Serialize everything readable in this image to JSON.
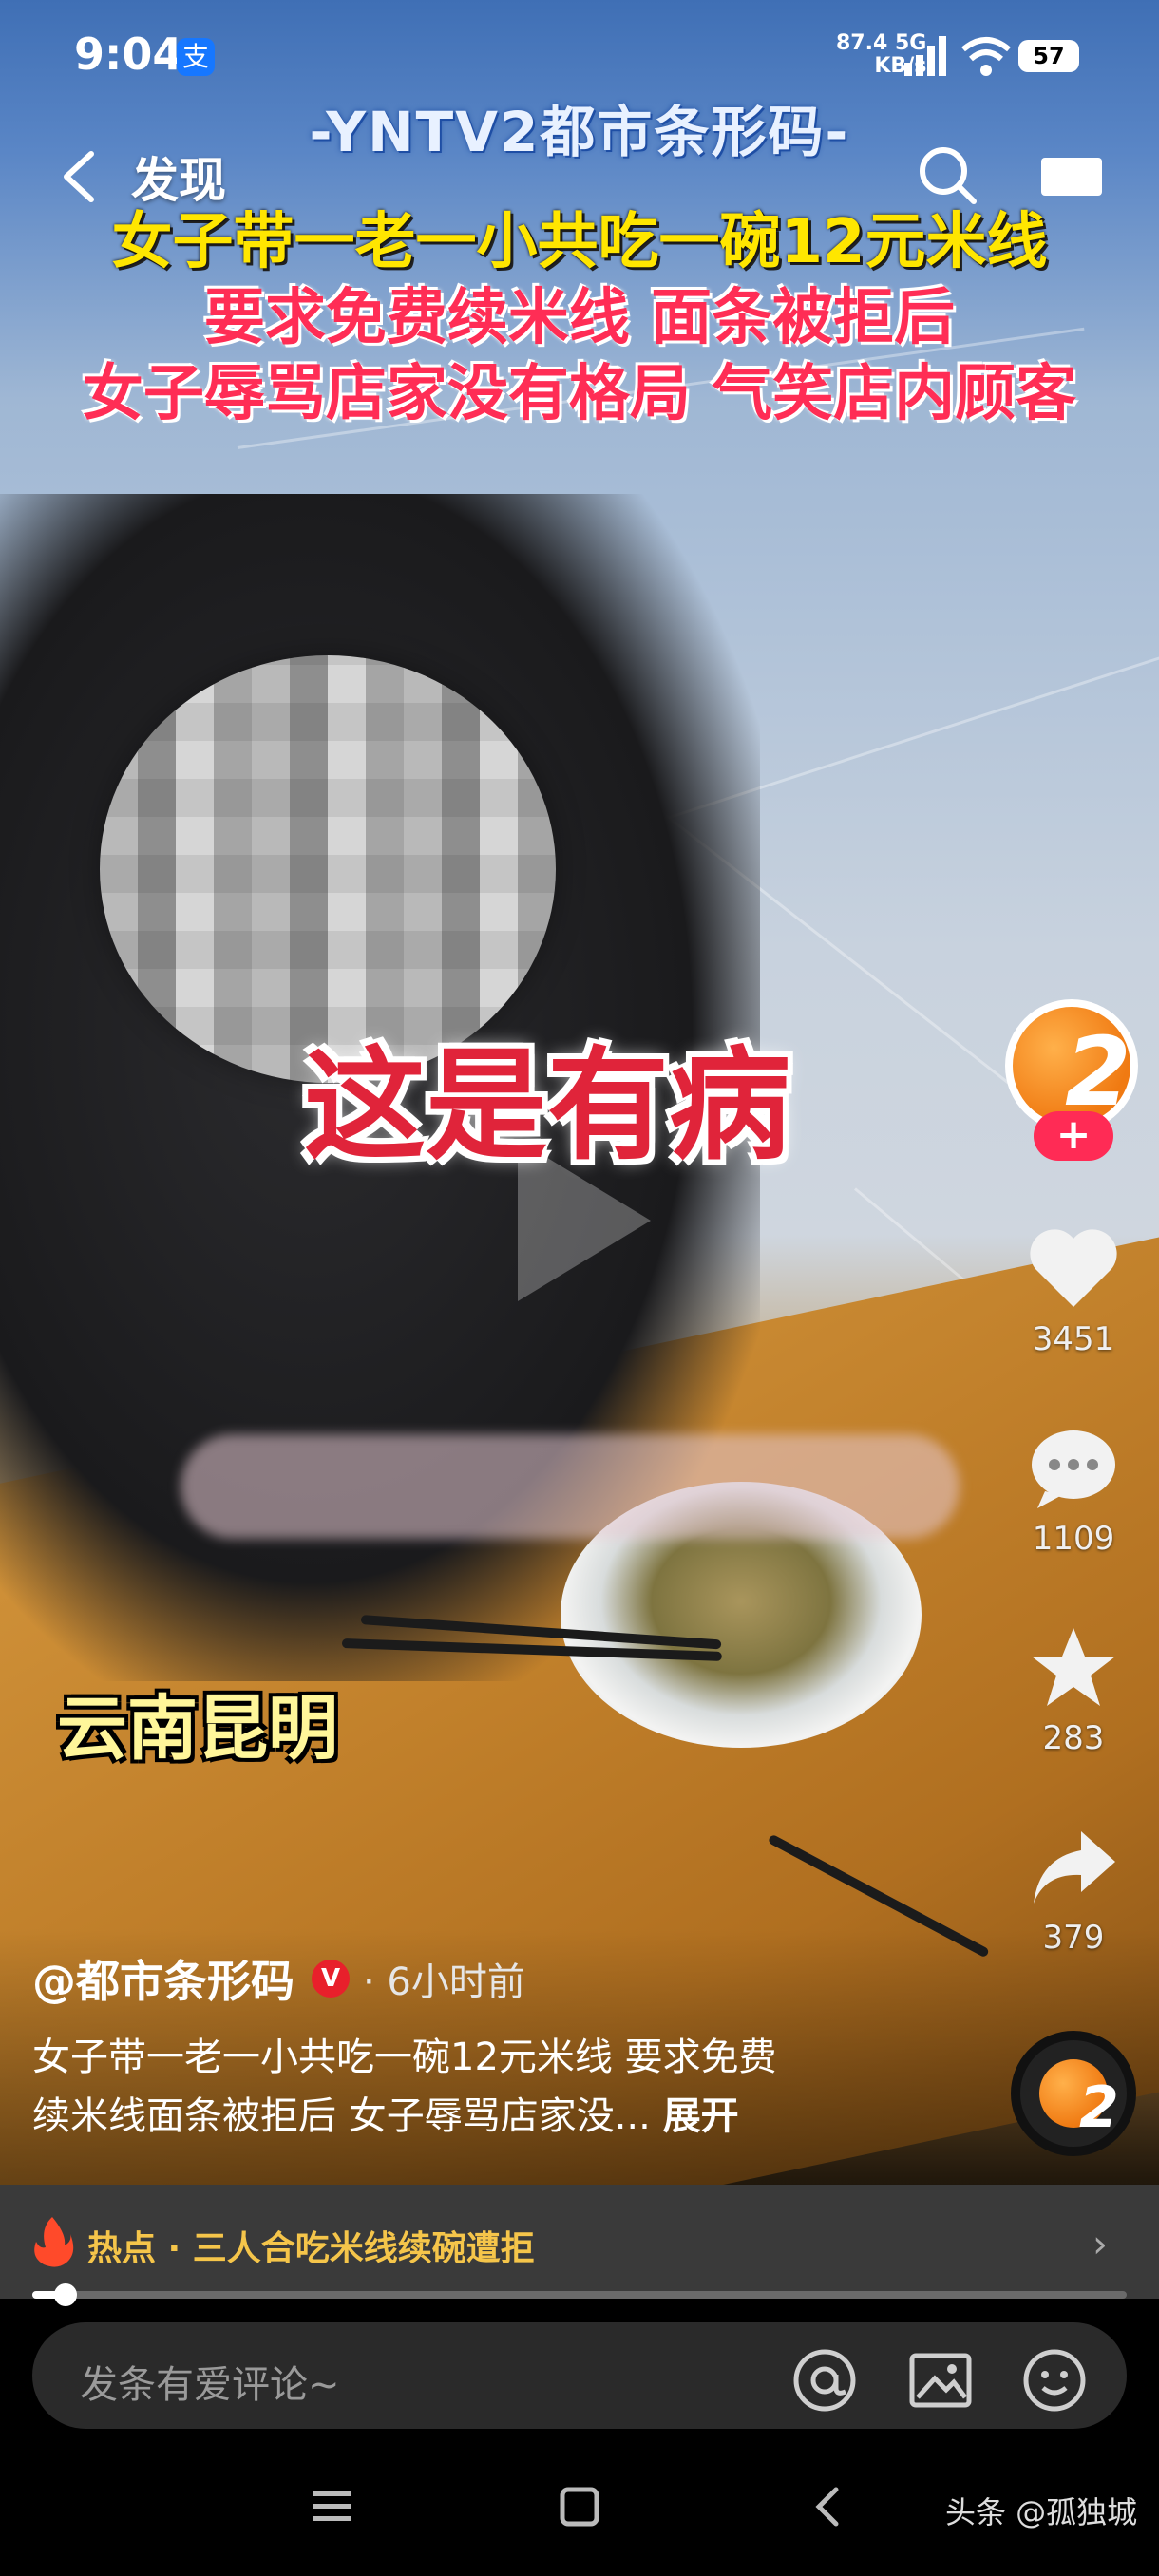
{
  "status_bar": {
    "time": "9:04",
    "alipay_icon": "支",
    "net_speed_value": "87.4",
    "net_speed_unit": "KB/s",
    "network_type": "5G",
    "battery": "57"
  },
  "nav": {
    "title": "发现"
  },
  "video": {
    "station_caption": "-YNTV2都市条形码-",
    "headline_1": "女子带一老一小共吃一碗12元米线",
    "headline_2": "要求免费续米线 面条被拒后",
    "headline_3": "女子辱骂店家没有格局  气笑店内顾客",
    "subtitle_quote": "这是有病",
    "location_caption": "云南昆明"
  },
  "rail": {
    "avatar_text": "2",
    "follow_label": "+",
    "likes": "3451",
    "comments": "1109",
    "favorites": "283",
    "shares": "379",
    "music_disc_text": "2"
  },
  "post": {
    "author": "@都市条形码",
    "verified_badge": "V",
    "time_ago": "· 6小时前",
    "description_line1": "女子带一老一小共吃一碗12元米线 要求免费",
    "description_line2": "续米线面条被拒后 女子辱骂店家没... ",
    "expand_label": "展开"
  },
  "hot": {
    "text": "热点 · 三人合吃米线续碗遭拒",
    "progress_percent": 3
  },
  "comment": {
    "placeholder": "发条有爱评论~"
  },
  "watermark": "头条 @孤独城",
  "colors": {
    "hot_text": "#f5c54a",
    "follow_badge": "#ff2b55",
    "headline_yellow": "#ffe600",
    "headline_red": "#ff2d55"
  }
}
